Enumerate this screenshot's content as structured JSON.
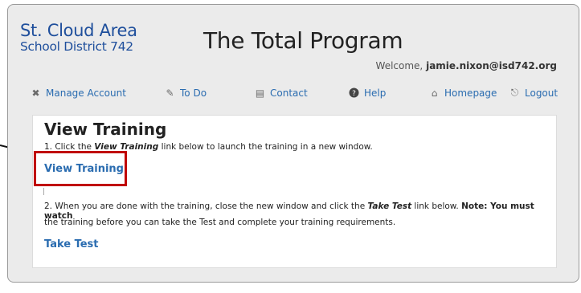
{
  "logo": {
    "line1": "St. Cloud Area",
    "line2": "School District 742"
  },
  "app_title": "The Total Program",
  "welcome": {
    "prefix": "Welcome,",
    "user": "jamie.nixon@isd742.org"
  },
  "nav": [
    {
      "label": "Manage Account",
      "icon": "tools-icon"
    },
    {
      "label": "To Do",
      "icon": "pencil-icon"
    },
    {
      "label": "Contact",
      "icon": "contact-card-icon"
    },
    {
      "label": "Help",
      "icon": "help-icon"
    },
    {
      "label": "Homepage",
      "icon": "home-icon"
    },
    {
      "label": "Logout",
      "icon": "logout-icon"
    }
  ],
  "panel": {
    "heading": "View Training",
    "step1": {
      "before": "1. Click the ",
      "link_term": "View Training",
      "after": " link below to launch the training in a new window."
    },
    "view_link": "View Training",
    "step2_line1": {
      "before": "2. When you are done with the training, close the new window and click the ",
      "link_term": "Take Test",
      "after": " link below.  ",
      "note": "Note: You must watch"
    },
    "step2_line2": "the training before you can take the Test and complete your training requirements.",
    "test_link": "Take Test"
  },
  "colors": {
    "accent": "#2a6cb0",
    "highlight": "#c00000",
    "logo": "#1f4f9c"
  }
}
